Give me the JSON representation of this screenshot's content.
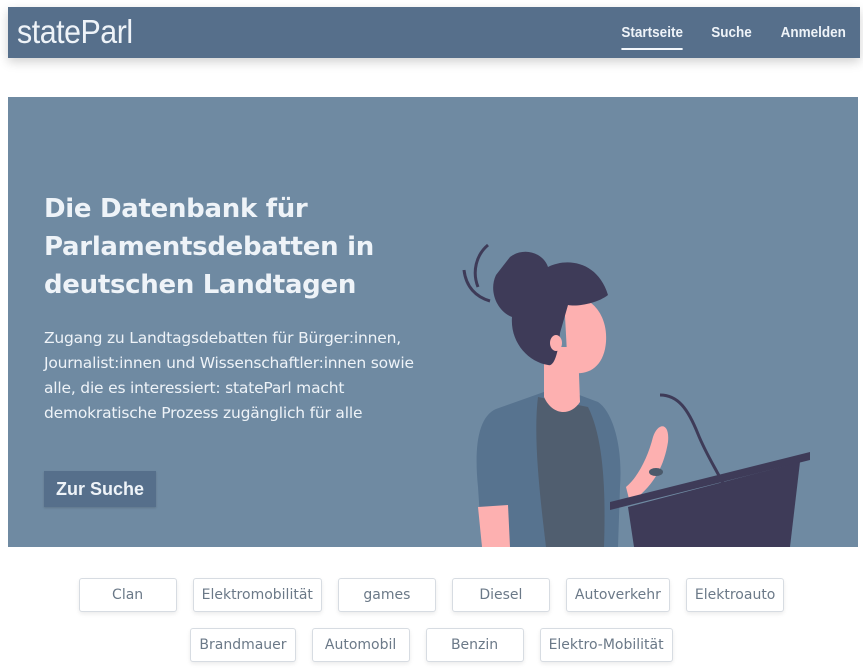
{
  "navbar": {
    "brand": "stateParl",
    "links": [
      {
        "label": "Startseite",
        "active": true
      },
      {
        "label": "Suche",
        "active": false
      },
      {
        "label": "Anmelden",
        "active": false
      }
    ]
  },
  "hero": {
    "title": "Die Datenbank für Parlamentsdebatten in deutschen Landtagen",
    "description": "Zugang zu Landtagsdebatten für Bürger:innen, Journalist:innen und Wissenschaftler:innen sowie alle, die es interessiert: stateParl macht demokratische Prozess zugänglich für alle",
    "cta_label": "Zur Suche",
    "illustration": "woman-speaking-at-podium"
  },
  "tags": [
    "Clan",
    "Elektromobilität",
    "games",
    "Diesel",
    "Autoverkehr",
    "Elektroauto",
    "Brandmauer",
    "Automobil",
    "Benzin",
    "Elektro-Mobilität"
  ],
  "colors": {
    "navbar": "#566f8b",
    "hero_bg": "#6f8aa2",
    "button": "#566f8b",
    "text_light": "#eef3f8",
    "tag_text": "#6b7988"
  }
}
